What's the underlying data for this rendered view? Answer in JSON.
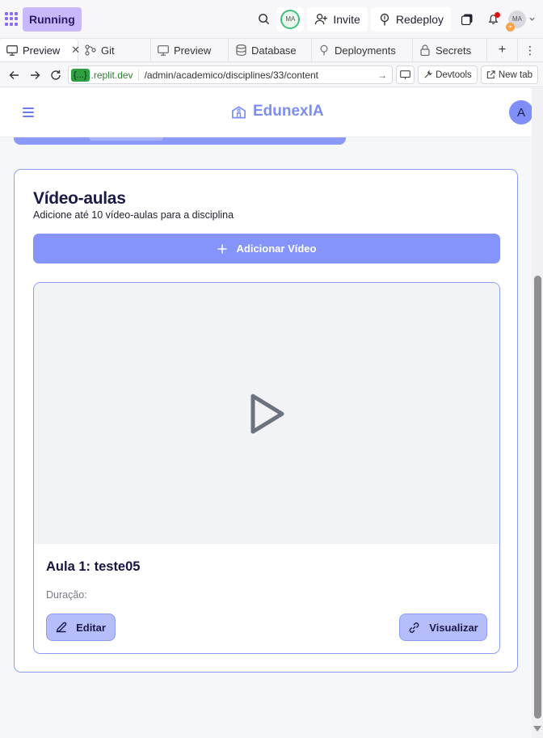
{
  "topbar": {
    "running_label": "Running",
    "avatar_initials": "MA",
    "invite_label": "Invite",
    "redeploy_label": "Redeploy",
    "user_initials": "MA"
  },
  "tabs": [
    {
      "label": "Preview",
      "icon": "monitor-icon",
      "active": true
    },
    {
      "label": "Git",
      "icon": "git-icon"
    },
    {
      "label": "Preview",
      "icon": "monitor-icon"
    },
    {
      "label": "Database",
      "icon": "database-icon"
    },
    {
      "label": "Deployments",
      "icon": "deploy-icon"
    },
    {
      "label": "Secrets",
      "icon": "lock-icon"
    }
  ],
  "address": {
    "domain_chip": "{...}",
    "domain": ".replit.dev",
    "path": "/admin/academico/disciplines/33/content",
    "devtools_label": "Devtools",
    "newtab_label": "New tab"
  },
  "app": {
    "brand": "EdunexIA",
    "user_avatar": "A",
    "section_title": "Vídeo-aulas",
    "section_subtitle": "Adicione até 10 vídeo-aulas para a disciplina",
    "add_button": "Adicionar Vídeo",
    "videos": [
      {
        "title": "Aula 1: teste05",
        "duration_label": "Duração:",
        "edit_label": "Editar",
        "view_label": "Visualizar"
      }
    ]
  },
  "colors": {
    "accent": "#8594fb",
    "brand": "#7c8ef0",
    "running": "#c9b8fb",
    "domain_chip": "#2ea043"
  }
}
